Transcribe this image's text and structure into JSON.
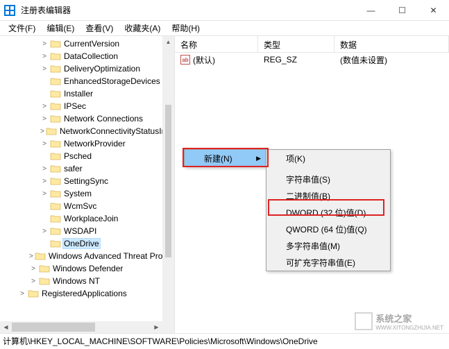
{
  "window": {
    "title": "注册表编辑器",
    "minimize": "—",
    "maximize": "☐",
    "close": "✕"
  },
  "menu": {
    "file": "文件(F)",
    "edit": "编辑(E)",
    "view": "查看(V)",
    "favorites": "收藏夹(A)",
    "help": "帮助(H)"
  },
  "columns": {
    "name": "名称",
    "type": "类型",
    "data": "数据"
  },
  "row": {
    "name": "(默认)",
    "type": "REG_SZ",
    "data": "(数值未设置)"
  },
  "tree": [
    {
      "indent": 58,
      "exp": ">",
      "label": "CurrentVersion"
    },
    {
      "indent": 58,
      "exp": ">",
      "label": "DataCollection"
    },
    {
      "indent": 58,
      "exp": ">",
      "label": "DeliveryOptimization"
    },
    {
      "indent": 58,
      "exp": "",
      "label": "EnhancedStorageDevices"
    },
    {
      "indent": 58,
      "exp": "",
      "label": "Installer"
    },
    {
      "indent": 58,
      "exp": ">",
      "label": "IPSec"
    },
    {
      "indent": 58,
      "exp": ">",
      "label": "Network Connections"
    },
    {
      "indent": 58,
      "exp": ">",
      "label": "NetworkConnectivityStatusIndicator"
    },
    {
      "indent": 58,
      "exp": ">",
      "label": "NetworkProvider"
    },
    {
      "indent": 58,
      "exp": "",
      "label": "Psched"
    },
    {
      "indent": 58,
      "exp": ">",
      "label": "safer"
    },
    {
      "indent": 58,
      "exp": ">",
      "label": "SettingSync"
    },
    {
      "indent": 58,
      "exp": ">",
      "label": "System"
    },
    {
      "indent": 58,
      "exp": "",
      "label": "WcmSvc"
    },
    {
      "indent": 58,
      "exp": "",
      "label": "WorkplaceJoin"
    },
    {
      "indent": 58,
      "exp": ">",
      "label": "WSDAPI"
    },
    {
      "indent": 58,
      "exp": "",
      "label": "OneDrive",
      "selected": true
    },
    {
      "indent": 42,
      "exp": ">",
      "label": "Windows Advanced Threat Protection"
    },
    {
      "indent": 42,
      "exp": ">",
      "label": "Windows Defender"
    },
    {
      "indent": 42,
      "exp": ">",
      "label": "Windows NT"
    },
    {
      "indent": 26,
      "exp": ">",
      "label": "RegisteredApplications"
    }
  ],
  "contextMenu": {
    "new": "新建(N)",
    "sub": [
      "项(K)",
      "字符串值(S)",
      "二进制值(B)",
      "DWORD (32 位)值(D)",
      "QWORD (64 位)值(Q)",
      "多字符串值(M)",
      "可扩充字符串值(E)"
    ]
  },
  "statusbar": "计算机\\HKEY_LOCAL_MACHINE\\SOFTWARE\\Policies\\Microsoft\\Windows\\OneDrive",
  "watermark": {
    "text": "系统之家",
    "url": "WWW.XITONGZHIJIA.NET"
  }
}
